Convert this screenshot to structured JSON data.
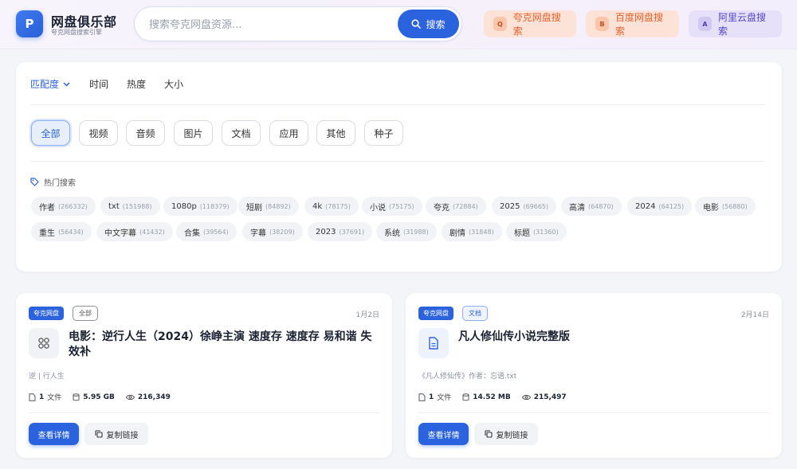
{
  "brand": {
    "logo_letter": "P",
    "title": "网盘俱乐部",
    "subtitle": "夸克网盘搜索引擎"
  },
  "search": {
    "placeholder": "搜索夸克网盘资源...",
    "button_label": "搜索"
  },
  "external": [
    {
      "badge": "Q",
      "label": "夸克网盘搜索"
    },
    {
      "badge": "B",
      "label": "百度网盘搜索"
    },
    {
      "badge": "A",
      "label": "阿里云盘搜索"
    }
  ],
  "sort": {
    "active": "匹配度",
    "options": [
      "匹配度",
      "时间",
      "热度",
      "大小"
    ]
  },
  "categories": [
    "全部",
    "视频",
    "音频",
    "图片",
    "文档",
    "应用",
    "其他",
    "种子"
  ],
  "hot": {
    "title": "热门搜索",
    "row1": [
      {
        "name": "作者",
        "count": "(266332)"
      },
      {
        "name": "txt",
        "count": "(151988)"
      },
      {
        "name": "1080p",
        "count": "(118379)"
      },
      {
        "name": "短剧",
        "count": "(84892)"
      },
      {
        "name": "4k",
        "count": "(78175)"
      },
      {
        "name": "小说",
        "count": "(75175)"
      },
      {
        "name": "夸克",
        "count": "(72884)"
      },
      {
        "name": "2025",
        "count": "(69665)"
      },
      {
        "name": "高清",
        "count": "(64870)"
      },
      {
        "name": "2024",
        "count": "(64125)"
      },
      {
        "name": "电影",
        "count": "(56880)"
      }
    ],
    "row2": [
      {
        "name": "重生",
        "count": "(56434)"
      },
      {
        "name": "中文字幕",
        "count": "(41432)"
      },
      {
        "name": "合集",
        "count": "(39564)"
      },
      {
        "name": "字幕",
        "count": "(38209)"
      },
      {
        "name": "2023",
        "count": "(37691)"
      },
      {
        "name": "系统",
        "count": "(31988)"
      },
      {
        "name": "剧情",
        "count": "(31848)"
      },
      {
        "name": "标题",
        "count": "(31360)"
      }
    ]
  },
  "results": [
    {
      "source": "夸克网盘",
      "category": "全部",
      "date": "1月2日",
      "title": "电影：逆行人生（2024）徐峥主演 速度存 速度存 易和谐 失效补",
      "desc": "逆 | 行人生",
      "files": "1",
      "files_unit": "文件",
      "size": "5.95 GB",
      "views": "216,349",
      "detail_label": "查看详情",
      "copy_label": "复制链接",
      "icon": "grid-icon"
    },
    {
      "source": "夸克网盘",
      "category": "文档",
      "date": "2月14日",
      "title": "凡人修仙传小说完整版",
      "desc": "《凡人修仙传》作者：忘语.txt",
      "files": "1",
      "files_unit": "文件",
      "size": "14.52 MB",
      "views": "215,497",
      "detail_label": "查看详情",
      "copy_label": "复制链接",
      "icon": "document-icon"
    }
  ],
  "colors": {
    "accent": "#2b63de",
    "quark_orange": "#e4622a",
    "ali_purple": "#5448c7"
  }
}
